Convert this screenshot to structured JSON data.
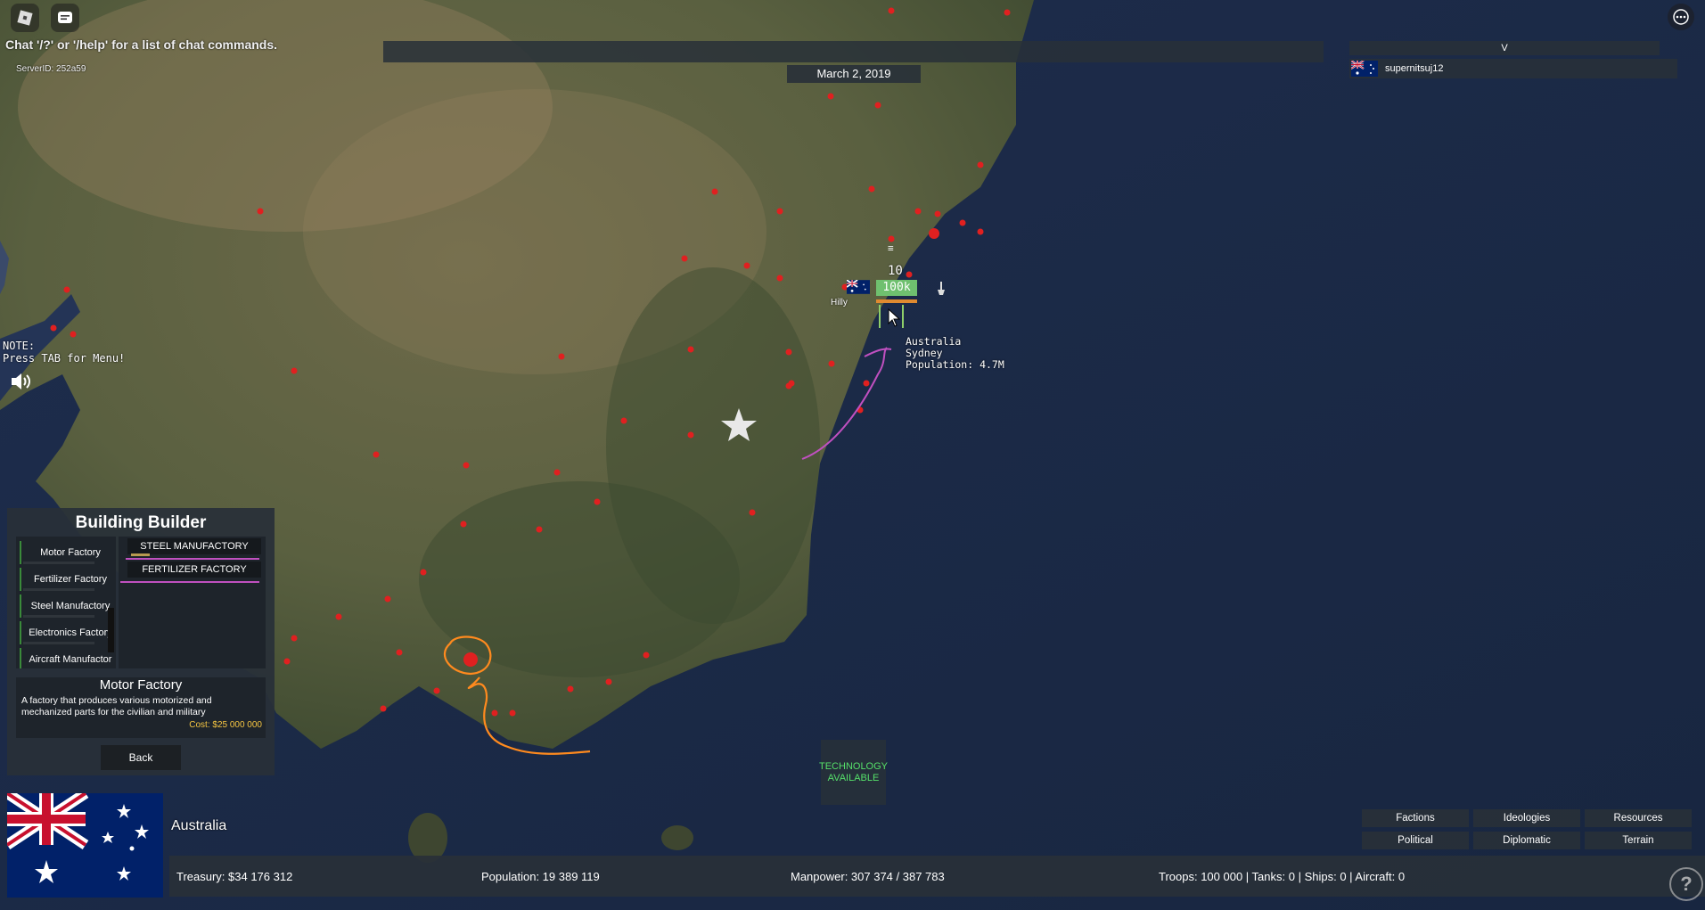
{
  "chat_hint": "Chat '/?' or '/help' for a list of chat commands.",
  "server_id": "ServerID: 252a59",
  "date": "March 2, 2019",
  "player_list": {
    "header": "V",
    "players": [
      {
        "name": "supernitsuj12",
        "flag": "australia-flag"
      }
    ]
  },
  "note": {
    "line1": "NOTE:",
    "line2": "Press TAB for Menu!"
  },
  "city_label": {
    "unit_count": "10",
    "troops": "100k",
    "unit_name": "Hilly",
    "country": "Australia",
    "city": "Sydney",
    "population": "Population: 4.7M"
  },
  "building_builder": {
    "title": "Building Builder",
    "items": [
      "Motor Factory",
      "Fertilizer Factory",
      "Steel Manufactory",
      "Electronics Factory",
      "Aircraft Manufactor"
    ],
    "queue": [
      "STEEL MANUFACTORY",
      "FERTILIZER FACTORY"
    ],
    "queue_progress": [
      0.15,
      0
    ],
    "selected": {
      "title": "Motor Factory",
      "description": "A factory that produces various motorized and mechanized parts for the civilian and military",
      "cost": "Cost: $25 000 000"
    },
    "back_label": "Back"
  },
  "tech_button": {
    "line1": "TECHNOLOGY",
    "line2": "AVAILABLE"
  },
  "country": {
    "name": "Australia",
    "flag": "australia-flag"
  },
  "stats": {
    "treasury": "Treasury:  $34 176 312",
    "population": "Population: 19 389 119",
    "manpower": "Manpower:  307 374  /  387 783",
    "military": "Troops: 100 000  |  Tanks: 0  |  Ships: 0  |  Aircraft: 0"
  },
  "menu": {
    "factions": "Factions",
    "ideologies": "Ideologies",
    "resources": "Resources",
    "political": "Political",
    "diplomatic": "Diplomatic",
    "terrain": "Terrain"
  },
  "icons": {
    "roblox": "roblox-logo-icon",
    "chat": "chat-icon",
    "more": "more-icon",
    "sound": "speaker-icon",
    "help": "help-icon",
    "capital": "star-icon"
  },
  "colors": {
    "ocean": "#1a2a4a",
    "land": "#6b6a45",
    "city_dot": "#e02020",
    "annotation_orange": "#ff8a1e",
    "annotation_purple": "#c050c0",
    "tech_green": "#55e06a",
    "cost_gold": "#f5c542"
  }
}
